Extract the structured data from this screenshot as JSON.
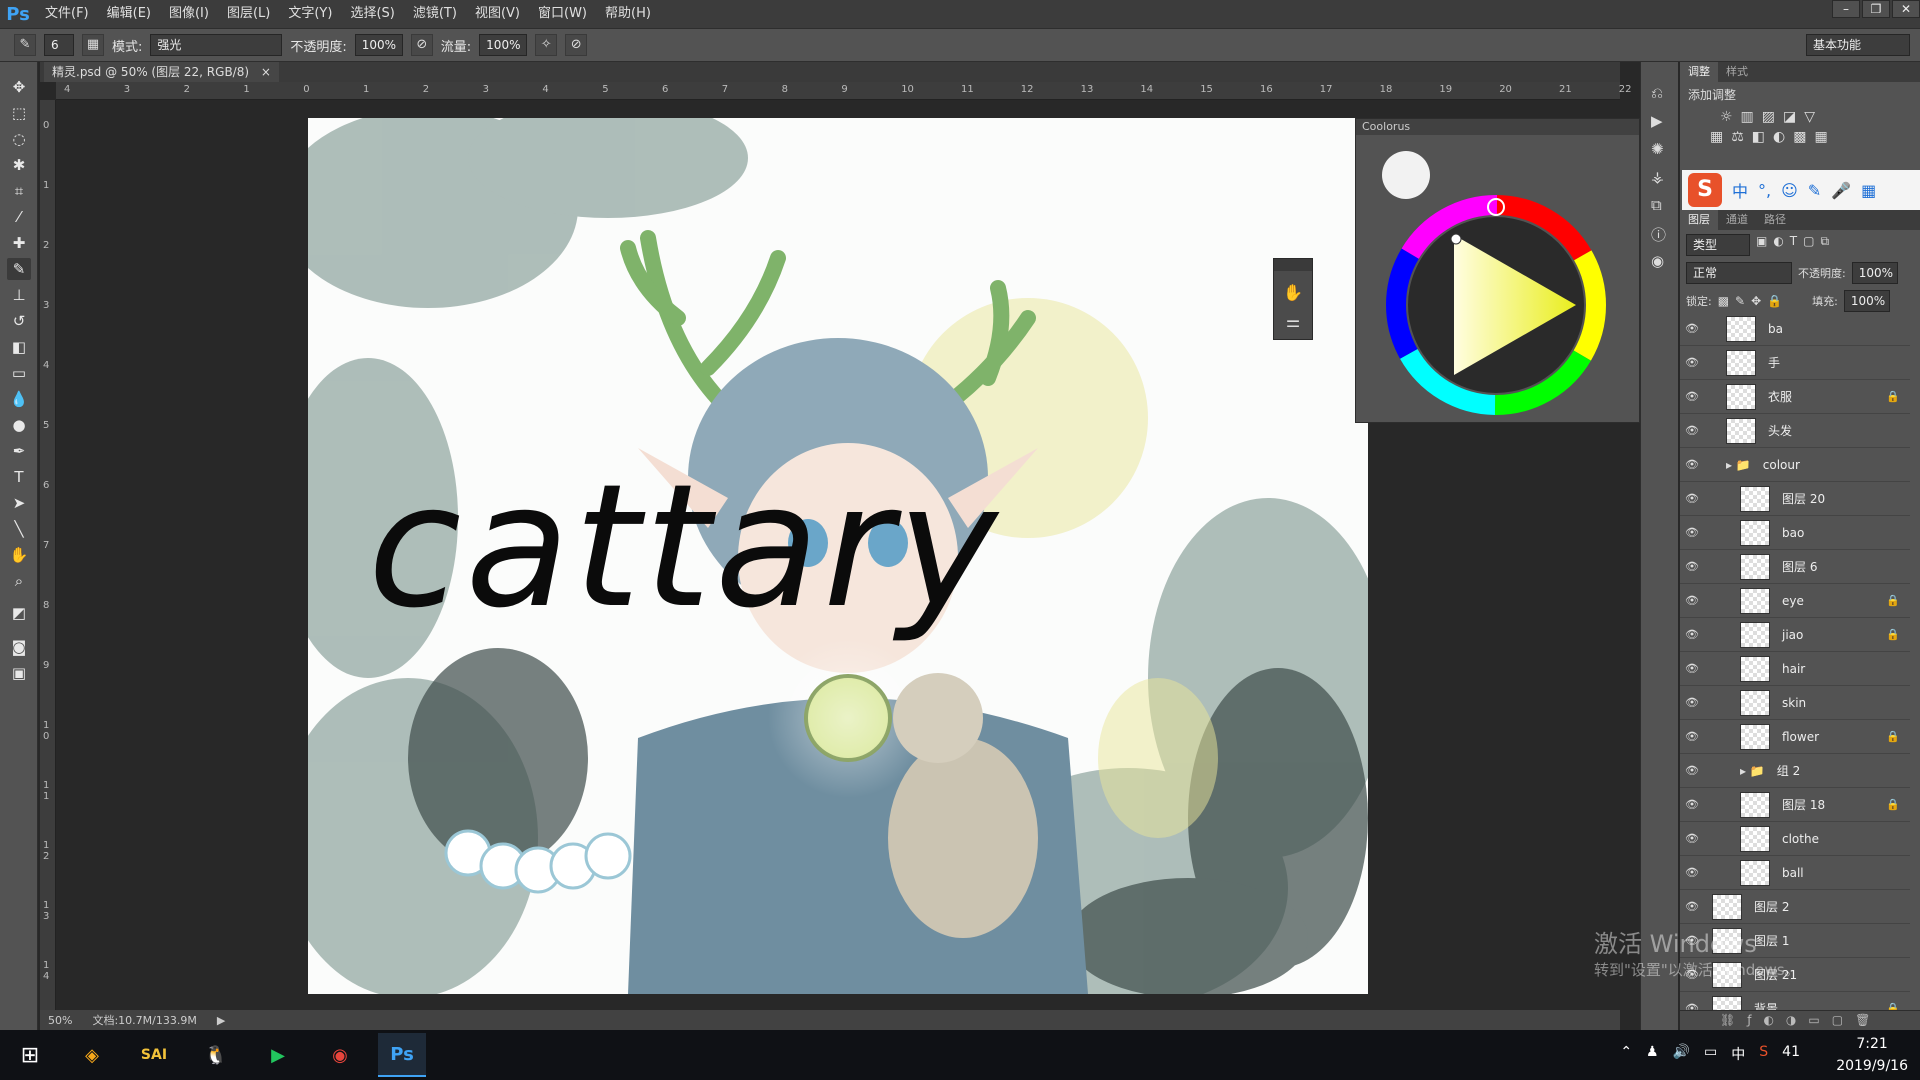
{
  "app": {
    "logo": "Ps"
  },
  "menu": [
    "文件(F)",
    "编辑(E)",
    "图像(I)",
    "图层(L)",
    "文字(Y)",
    "选择(S)",
    "滤镜(T)",
    "视图(V)",
    "窗口(W)",
    "帮助(H)"
  ],
  "options": {
    "brush_size": "6",
    "mode_label": "模式:",
    "mode_value": "强光",
    "opacity_label": "不透明度:",
    "opacity_value": "100%",
    "flow_label": "流量:",
    "flow_value": "100%",
    "workspace": "基本功能"
  },
  "document_tab": {
    "title": "精灵.psd @ 50% (图层 22, RGB/8)",
    "close": "×"
  },
  "ruler_top_ticks": [
    "4",
    "3",
    "2",
    "1",
    "0",
    "1",
    "2",
    "3",
    "4",
    "5",
    "6",
    "7",
    "8",
    "9",
    "10",
    "11",
    "12",
    "13",
    "14",
    "15",
    "16",
    "17",
    "18",
    "19",
    "20",
    "21",
    "22"
  ],
  "ruler_left_ticks": [
    "0",
    "1",
    "2",
    "3",
    "4",
    "5",
    "6",
    "7",
    "8",
    "9",
    "1 0",
    "1 1",
    "1 2",
    "1 3",
    "1 4"
  ],
  "canvas_text": "cattary",
  "status": {
    "zoom": "50%",
    "doc": "文档:10.7M/133.9M"
  },
  "coolorus": {
    "title": "Coolorus"
  },
  "right_panel": {
    "adjust_tabs": [
      "调整",
      "样式"
    ],
    "add_adjustment": "添加调整",
    "layer_tabs": [
      "图层",
      "通道",
      "路径"
    ],
    "filter_kind": "类型",
    "blend_mode": "正常",
    "opacity_label": "不透明度:",
    "opacity_value": "100%",
    "lock_label": "锁定:",
    "fill_label": "填充:",
    "fill_value": "100%"
  },
  "layers": [
    {
      "name": "ba",
      "locked": false,
      "indent": 1
    },
    {
      "name": "手",
      "locked": false,
      "indent": 1
    },
    {
      "name": "衣服",
      "locked": true,
      "indent": 1
    },
    {
      "name": "头发",
      "locked": false,
      "indent": 1
    },
    {
      "name": "colour",
      "locked": false,
      "indent": 1,
      "group": true
    },
    {
      "name": "图层 20",
      "locked": false,
      "indent": 2
    },
    {
      "name": "bao",
      "locked": false,
      "indent": 2
    },
    {
      "name": "图层 6",
      "locked": false,
      "indent": 2
    },
    {
      "name": "eye",
      "locked": true,
      "indent": 2
    },
    {
      "name": "jiao",
      "locked": true,
      "indent": 2
    },
    {
      "name": "hair",
      "locked": false,
      "indent": 2
    },
    {
      "name": "skin",
      "locked": false,
      "indent": 2
    },
    {
      "name": "flower",
      "locked": true,
      "indent": 2
    },
    {
      "name": "组 2",
      "locked": false,
      "indent": 2,
      "group": true
    },
    {
      "name": "图层 18",
      "locked": true,
      "indent": 2
    },
    {
      "name": "clothe",
      "locked": false,
      "indent": 2
    },
    {
      "name": "ball",
      "locked": false,
      "indent": 2
    },
    {
      "name": "图层 2",
      "locked": false,
      "indent": 0
    },
    {
      "name": "图层 1",
      "locked": false,
      "indent": 0
    },
    {
      "name": "图层 21",
      "locked": false,
      "indent": 0
    },
    {
      "name": "背景",
      "locked": true,
      "indent": 0
    }
  ],
  "watermark": {
    "line1": "激活 Windows",
    "line2": "转到\"设置\"以激活 Windows。"
  },
  "taskbar": {
    "tray_ime": "中",
    "tray_num": "41",
    "time": "7:21",
    "date": "2019/9/16"
  },
  "colors": {
    "accent": "#3fa3f5",
    "panel": "#535353",
    "dark": "#282828"
  }
}
